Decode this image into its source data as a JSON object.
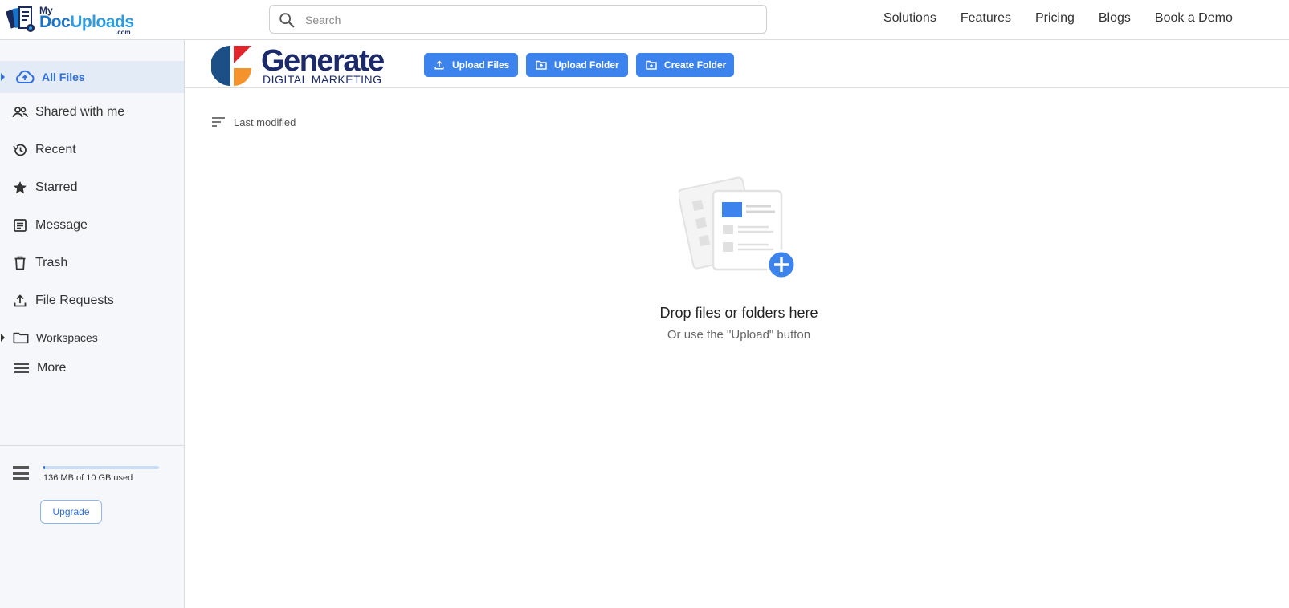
{
  "header": {
    "logo": {
      "my": "My",
      "doc": "Doc",
      "uploads": "Uploads",
      "com": ".com"
    },
    "search": {
      "placeholder": "Search"
    },
    "nav": [
      "Solutions",
      "Features",
      "Pricing",
      "Blogs",
      "Book a Demo"
    ]
  },
  "sidebar": {
    "items": [
      {
        "label": "All Files",
        "icon": "cloud-upload-icon",
        "active": true
      },
      {
        "label": "Shared with me",
        "icon": "people-icon"
      },
      {
        "label": "Recent",
        "icon": "history-icon"
      },
      {
        "label": "Starred",
        "icon": "star-icon"
      },
      {
        "label": "Message",
        "icon": "message-icon"
      },
      {
        "label": "Trash",
        "icon": "trash-icon"
      },
      {
        "label": "File Requests",
        "icon": "upload-icon"
      },
      {
        "label": "Workspaces",
        "icon": "folder-icon"
      },
      {
        "label": "More",
        "icon": "menu-icon"
      }
    ],
    "storage": {
      "text": "136 MB of 10 GB used",
      "used_fraction": 0.0136
    },
    "upgrade_label": "Upgrade"
  },
  "toolbar": {
    "brand": {
      "name": "Generate",
      "sub": "DIGITAL MARKETING"
    },
    "upload_files": "Upload Files",
    "upload_folder": "Upload Folder",
    "create_folder": "Create Folder"
  },
  "main": {
    "sort_label": "Last modified",
    "empty_title": "Drop files or folders here",
    "empty_subtitle": "Or use the \"Upload\" button"
  },
  "colors": {
    "accent": "#3d83ee",
    "active_text": "#2f6fe0",
    "sidebar_bg": "#f5f7fa",
    "brand_navy": "#1c2a6a"
  }
}
